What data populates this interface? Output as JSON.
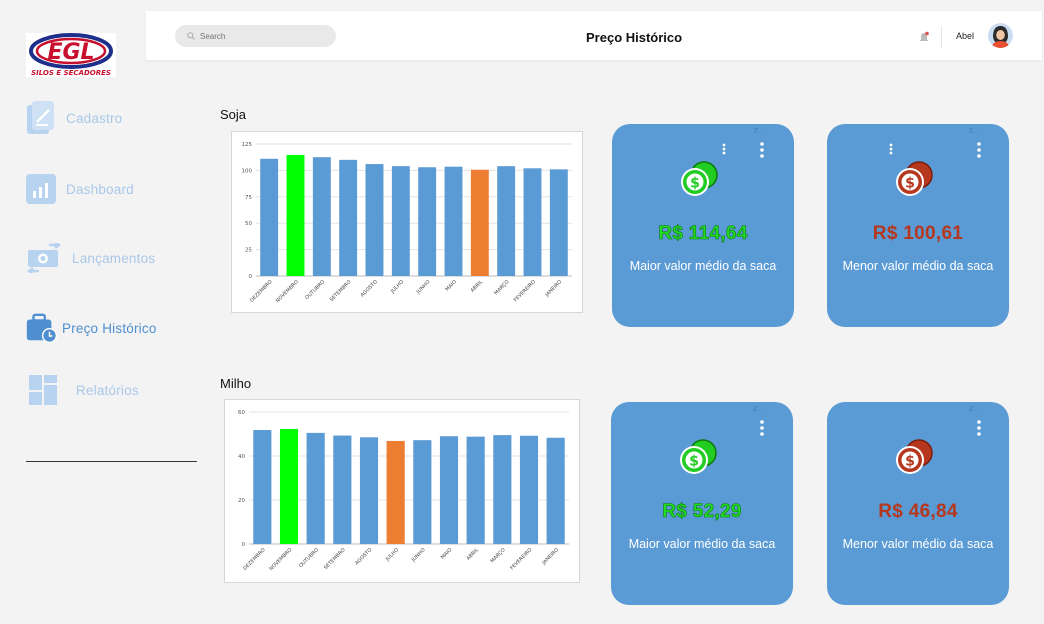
{
  "logo": {
    "text": "EGL",
    "subtitle": "SILOS E SECADORES"
  },
  "sidebar": {
    "items": [
      {
        "label": "Cadastro",
        "icon": "document-icon"
      },
      {
        "label": "Dashboard",
        "icon": "bar-chart-icon"
      },
      {
        "label": "Lançamentos",
        "icon": "money-transfer-icon"
      },
      {
        "label": "Preço Histórico",
        "icon": "briefcase-clock-icon"
      },
      {
        "label": "Relatórios",
        "icon": "grid-layout-icon"
      }
    ],
    "active": "Preço Histórico"
  },
  "header": {
    "search_placeholder": "Search",
    "title": "Preço Histórico",
    "user_name": "Abel"
  },
  "sections": {
    "soja": {
      "label": "Soja"
    },
    "milho": {
      "label": "Milho"
    }
  },
  "colors": {
    "bar_default": "#5b9bd5",
    "bar_max": "#00ff00",
    "bar_min": "#ed7d31",
    "card_bg": "#5b9bd5"
  },
  "chart_data": [
    {
      "type": "bar",
      "categories": [
        "DEZEMBRO",
        "NOVEMBRO",
        "OUTUBRO",
        "SETEMBRO",
        "AGOSTO",
        "JULHO",
        "JUNHO",
        "MAIO",
        "ABRIL",
        "MARÇO",
        "FEVEREIRO",
        "JANEIRO"
      ],
      "values": [
        111,
        114.64,
        112.5,
        110,
        106,
        104,
        103,
        103.5,
        100.61,
        104,
        102,
        101
      ],
      "highlight_max_index": 1,
      "highlight_min_index": 8,
      "ylim": [
        0,
        125
      ],
      "yticks": [
        0,
        25,
        50,
        75,
        100,
        125
      ],
      "grid": true
    },
    {
      "type": "bar",
      "categories": [
        "DEZEMBRO",
        "NOVEMBRO",
        "OUTUBRO",
        "SETEMBRO",
        "AGOSTO",
        "JULHO",
        "JUNHO",
        "MAIO",
        "ABRIL",
        "MARÇO",
        "FEVEREIRO",
        "JANEIRO"
      ],
      "values": [
        51.8,
        52.29,
        50.5,
        49.3,
        48.5,
        46.84,
        47.2,
        49,
        48.8,
        49.5,
        49.2,
        48.3
      ],
      "highlight_max_index": 1,
      "highlight_min_index": 5,
      "ylim": [
        0,
        60
      ],
      "yticks": [
        0,
        20,
        40,
        60
      ],
      "grid": true
    }
  ],
  "cards": [
    {
      "value": "R$ 114,64",
      "label": "Maior valor médio da saca",
      "kind": "max",
      "z": "Z..."
    },
    {
      "value": "R$ 100,61",
      "label": "Menor valor médio da saca",
      "kind": "min",
      "z": "Z..."
    },
    {
      "value": "R$ 52,29",
      "label": "Maior valor médio da saca",
      "kind": "max",
      "z": "Z..."
    },
    {
      "value": "R$ 46,84",
      "label": "Menor valor médio da saca",
      "kind": "min",
      "z": "Z..."
    }
  ]
}
